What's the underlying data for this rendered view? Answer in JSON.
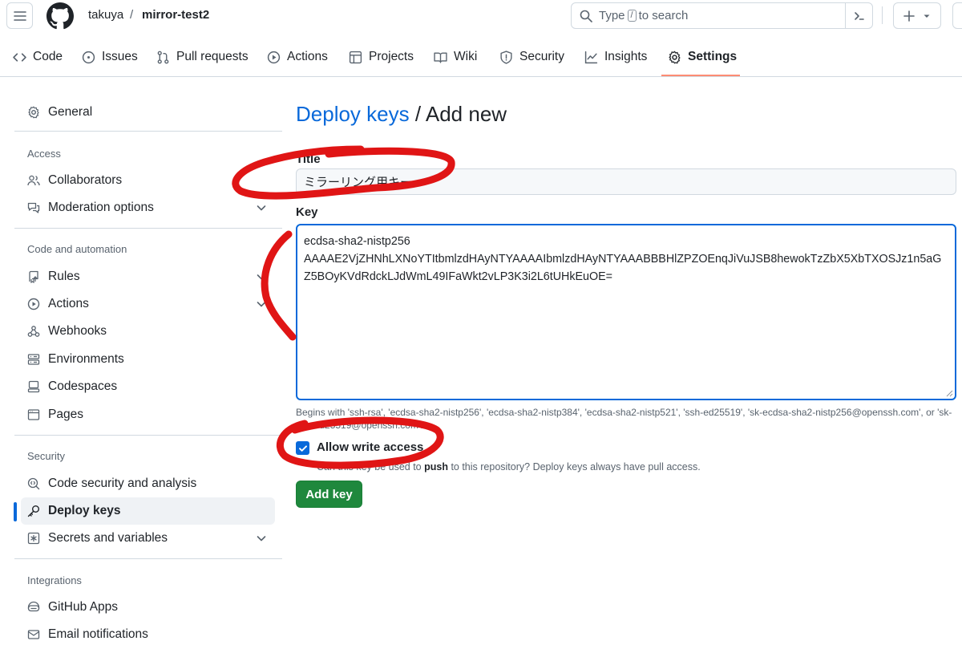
{
  "header": {
    "owner": "takuya",
    "separator": "/",
    "repo": "mirror-test2",
    "search_prefix": "Type",
    "search_key": "/",
    "search_suffix": "to search"
  },
  "tabs": [
    {
      "label": "Code",
      "icon": "code-icon"
    },
    {
      "label": "Issues",
      "icon": "issue-opened-icon"
    },
    {
      "label": "Pull requests",
      "icon": "git-pull-request-icon"
    },
    {
      "label": "Actions",
      "icon": "play-icon"
    },
    {
      "label": "Projects",
      "icon": "table-icon"
    },
    {
      "label": "Wiki",
      "icon": "book-icon"
    },
    {
      "label": "Security",
      "icon": "shield-icon"
    },
    {
      "label": "Insights",
      "icon": "graph-icon"
    },
    {
      "label": "Settings",
      "icon": "gear-icon",
      "selected": true
    }
  ],
  "sidebar": {
    "general": "General",
    "access": {
      "heading": "Access",
      "items": [
        "Collaborators",
        "Moderation options"
      ]
    },
    "code_automation": {
      "heading": "Code and automation",
      "items": [
        "Rules",
        "Actions",
        "Webhooks",
        "Environments",
        "Codespaces",
        "Pages"
      ]
    },
    "security": {
      "heading": "Security",
      "items": [
        "Code security and analysis",
        "Deploy keys",
        "Secrets and variables"
      ]
    },
    "integrations": {
      "heading": "Integrations",
      "items": [
        "GitHub Apps",
        "Email notifications"
      ]
    }
  },
  "main": {
    "title_link": "Deploy keys",
    "title_sep": " / ",
    "title_rest": "Add new",
    "title_label": "Title",
    "title_value": "ミラーリング用キー",
    "key_label": "Key",
    "key_line1": "ecdsa-sha2-nistp256",
    "key_line2": "AAAAE2VjZHNhLXNoYTItbmlzdHAyNTYAAAAIbmlzdHAyNTYAAABBBHlZPZOEnqJiVuJSB8hewokTzZbX5XbTXOSJz1n5aGZ5BOyKVdRdckLJdWmL49IFaWkt2vLP3K3i2L6tUHkEuOE=",
    "key_note": "Begins with 'ssh-rsa', 'ecdsa-sha2-nistp256', 'ecdsa-sha2-nistp384', 'ecdsa-sha2-nistp521', 'ssh-ed25519', 'sk-ecdsa-sha2-nistp256@openssh.com', or 'sk-ssh-ed25519@openssh.com'.",
    "allow_write_label": "Allow write access",
    "allow_write_checked": true,
    "hint_prefix": "Can this key be used to ",
    "hint_bold": "push",
    "hint_suffix": " to this repository? Deploy keys always have pull access.",
    "add_button": "Add key"
  },
  "colors": {
    "accent": "#0969da",
    "primary_button": "#1f883d",
    "tab_underline": "#fd8c73",
    "annotation": "#e01515"
  }
}
